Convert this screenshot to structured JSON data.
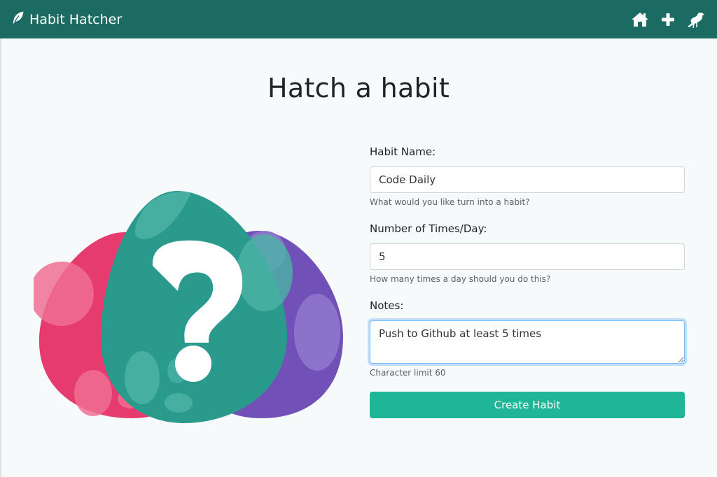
{
  "navbar": {
    "brand": "Habit Hatcher",
    "icons": [
      "home-icon",
      "plus-icon",
      "crow-icon"
    ]
  },
  "page": {
    "title": "Hatch a habit"
  },
  "form": {
    "habit_name": {
      "label": "Habit Name:",
      "value": "Code Daily",
      "help": "What would you like turn into a habit?"
    },
    "times_per_day": {
      "label": "Number of Times/Day:",
      "value": "5",
      "help": "How many times a day should you do this?"
    },
    "notes": {
      "label": "Notes:",
      "value": "Push to Github at least 5 times",
      "help": "Character limit 60"
    },
    "submit_label": "Create Habit"
  },
  "colors": {
    "navbar": "#1b6b62",
    "button": "#1fb597",
    "egg_pink": "#e63b6f",
    "egg_teal": "#2a9a8d",
    "egg_purple": "#7150b8"
  }
}
